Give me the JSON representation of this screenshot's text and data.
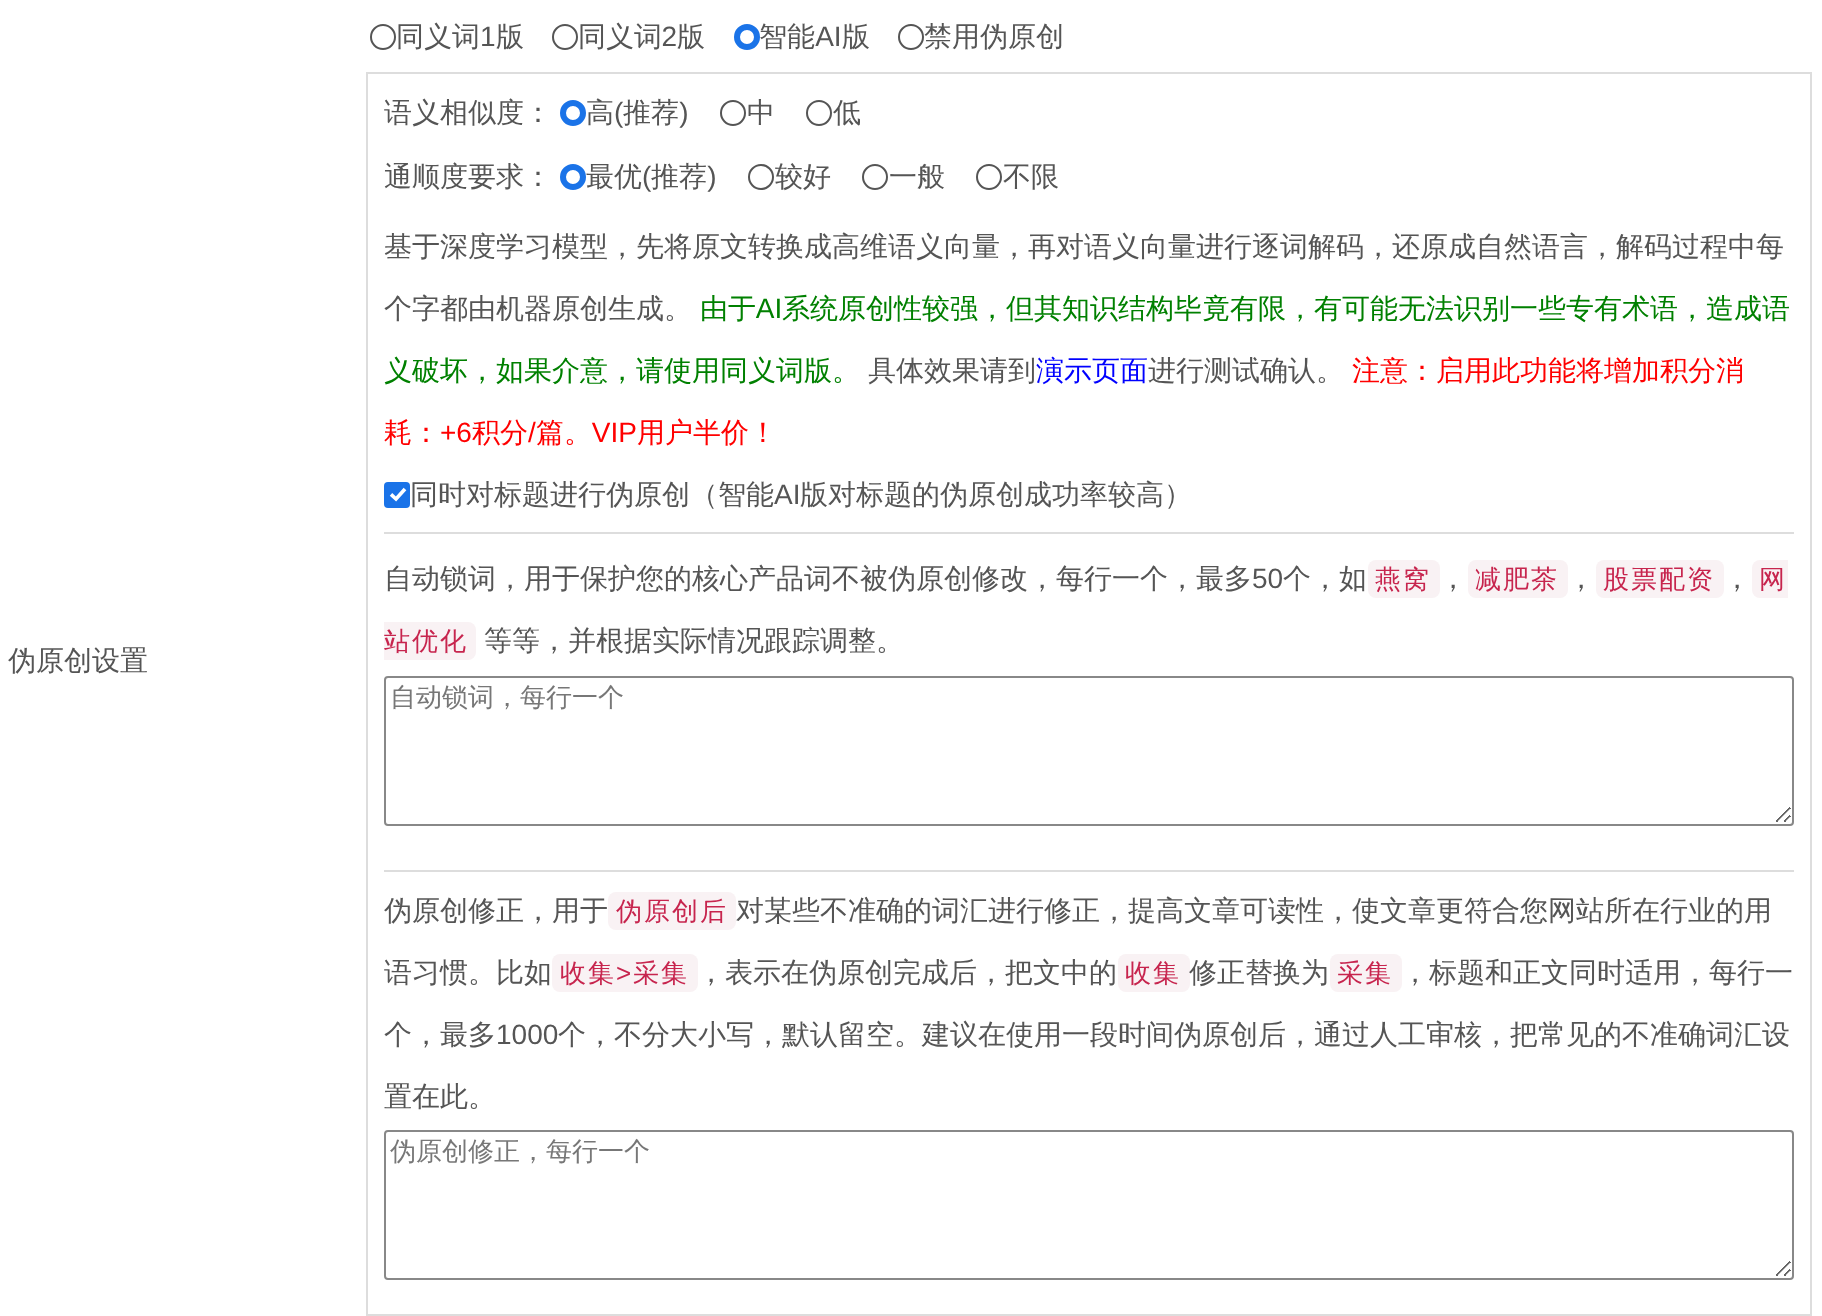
{
  "section_label": "伪原创设置",
  "modes": [
    {
      "label": "同义词1版",
      "selected": false
    },
    {
      "label": "同义词2版",
      "selected": false
    },
    {
      "label": "智能AI版",
      "selected": true
    },
    {
      "label": "禁用伪原创",
      "selected": false
    }
  ],
  "settings": [
    {
      "label": "语义相似度：",
      "options": [
        {
          "label": "高(推荐)",
          "selected": true
        },
        {
          "label": "中",
          "selected": false
        },
        {
          "label": "低",
          "selected": false
        }
      ]
    },
    {
      "label": "通顺度要求：",
      "options": [
        {
          "label": "最优(推荐)",
          "selected": true
        },
        {
          "label": "较好",
          "selected": false
        },
        {
          "label": "一般",
          "selected": false
        },
        {
          "label": "不限",
          "selected": false
        }
      ]
    }
  ],
  "ai_description": [
    {
      "kind": "text",
      "text": "基于深度学习模型，先将原文转换成高维语义向量，再对语义向量进行逐词解码，还原成自然语言，解码过程中每个字都由机器原创生成。 "
    },
    {
      "kind": "good",
      "text": "由于AI系统原创性较强，但其知识结构毕竟有限，有可能无法识别一些专有术语，造成语义破坏，如果介意，请使用同义词版。 "
    },
    {
      "kind": "text",
      "text": "具体效果请到"
    },
    {
      "kind": "link",
      "text": "演示页面"
    },
    {
      "kind": "text",
      "text": "进行测试确认。 "
    },
    {
      "kind": "warning",
      "text": "注意：启用此功能将增加积分消耗：+6积分/篇。VIP用户半价！"
    }
  ],
  "title_option": {
    "label": "同时对标题进行伪原创（智能AI版对标题的伪原创成功率较高）",
    "checked": true
  },
  "lock_words": {
    "description": [
      {
        "kind": "text",
        "text": "自动锁词，用于保护您的核心产品词不被伪原创修改，每行一个，最多50个，如"
      },
      {
        "kind": "tag",
        "text": "燕窝"
      },
      {
        "kind": "text",
        "text": "，"
      },
      {
        "kind": "tag",
        "text": "减肥茶"
      },
      {
        "kind": "text",
        "text": "，"
      },
      {
        "kind": "tag",
        "text": "股票配资"
      },
      {
        "kind": "text",
        "text": "，"
      },
      {
        "kind": "tag",
        "text": "网站优化"
      },
      {
        "kind": "text",
        "text": " 等等，并根据实际情况跟踪调整。"
      }
    ],
    "placeholder": "自动锁词，每行一个"
  },
  "correction": {
    "description": [
      {
        "kind": "text",
        "text": "伪原创修正，用于"
      },
      {
        "kind": "tag",
        "text": "伪原创后"
      },
      {
        "kind": "text",
        "text": "对某些不准确的词汇进行修正，提高文章可读性，使文章更符合您网站所在行业的用语习惯。比如"
      },
      {
        "kind": "tag",
        "text": "收集>采集"
      },
      {
        "kind": "text",
        "text": "，表示在伪原创完成后，把文中的"
      },
      {
        "kind": "tag",
        "text": "收集"
      },
      {
        "kind": "text",
        "text": "修正替换为"
      },
      {
        "kind": "tag",
        "text": "采集"
      },
      {
        "kind": "text",
        "text": "，标题和正文同时适用，每行一个，最多1000个，不分大小写，默认留空。建议在使用一段时间伪原创后，通过人工审核，把常见的不准确词汇设置在此。"
      }
    ],
    "placeholder": "伪原创修正，每行一个"
  }
}
